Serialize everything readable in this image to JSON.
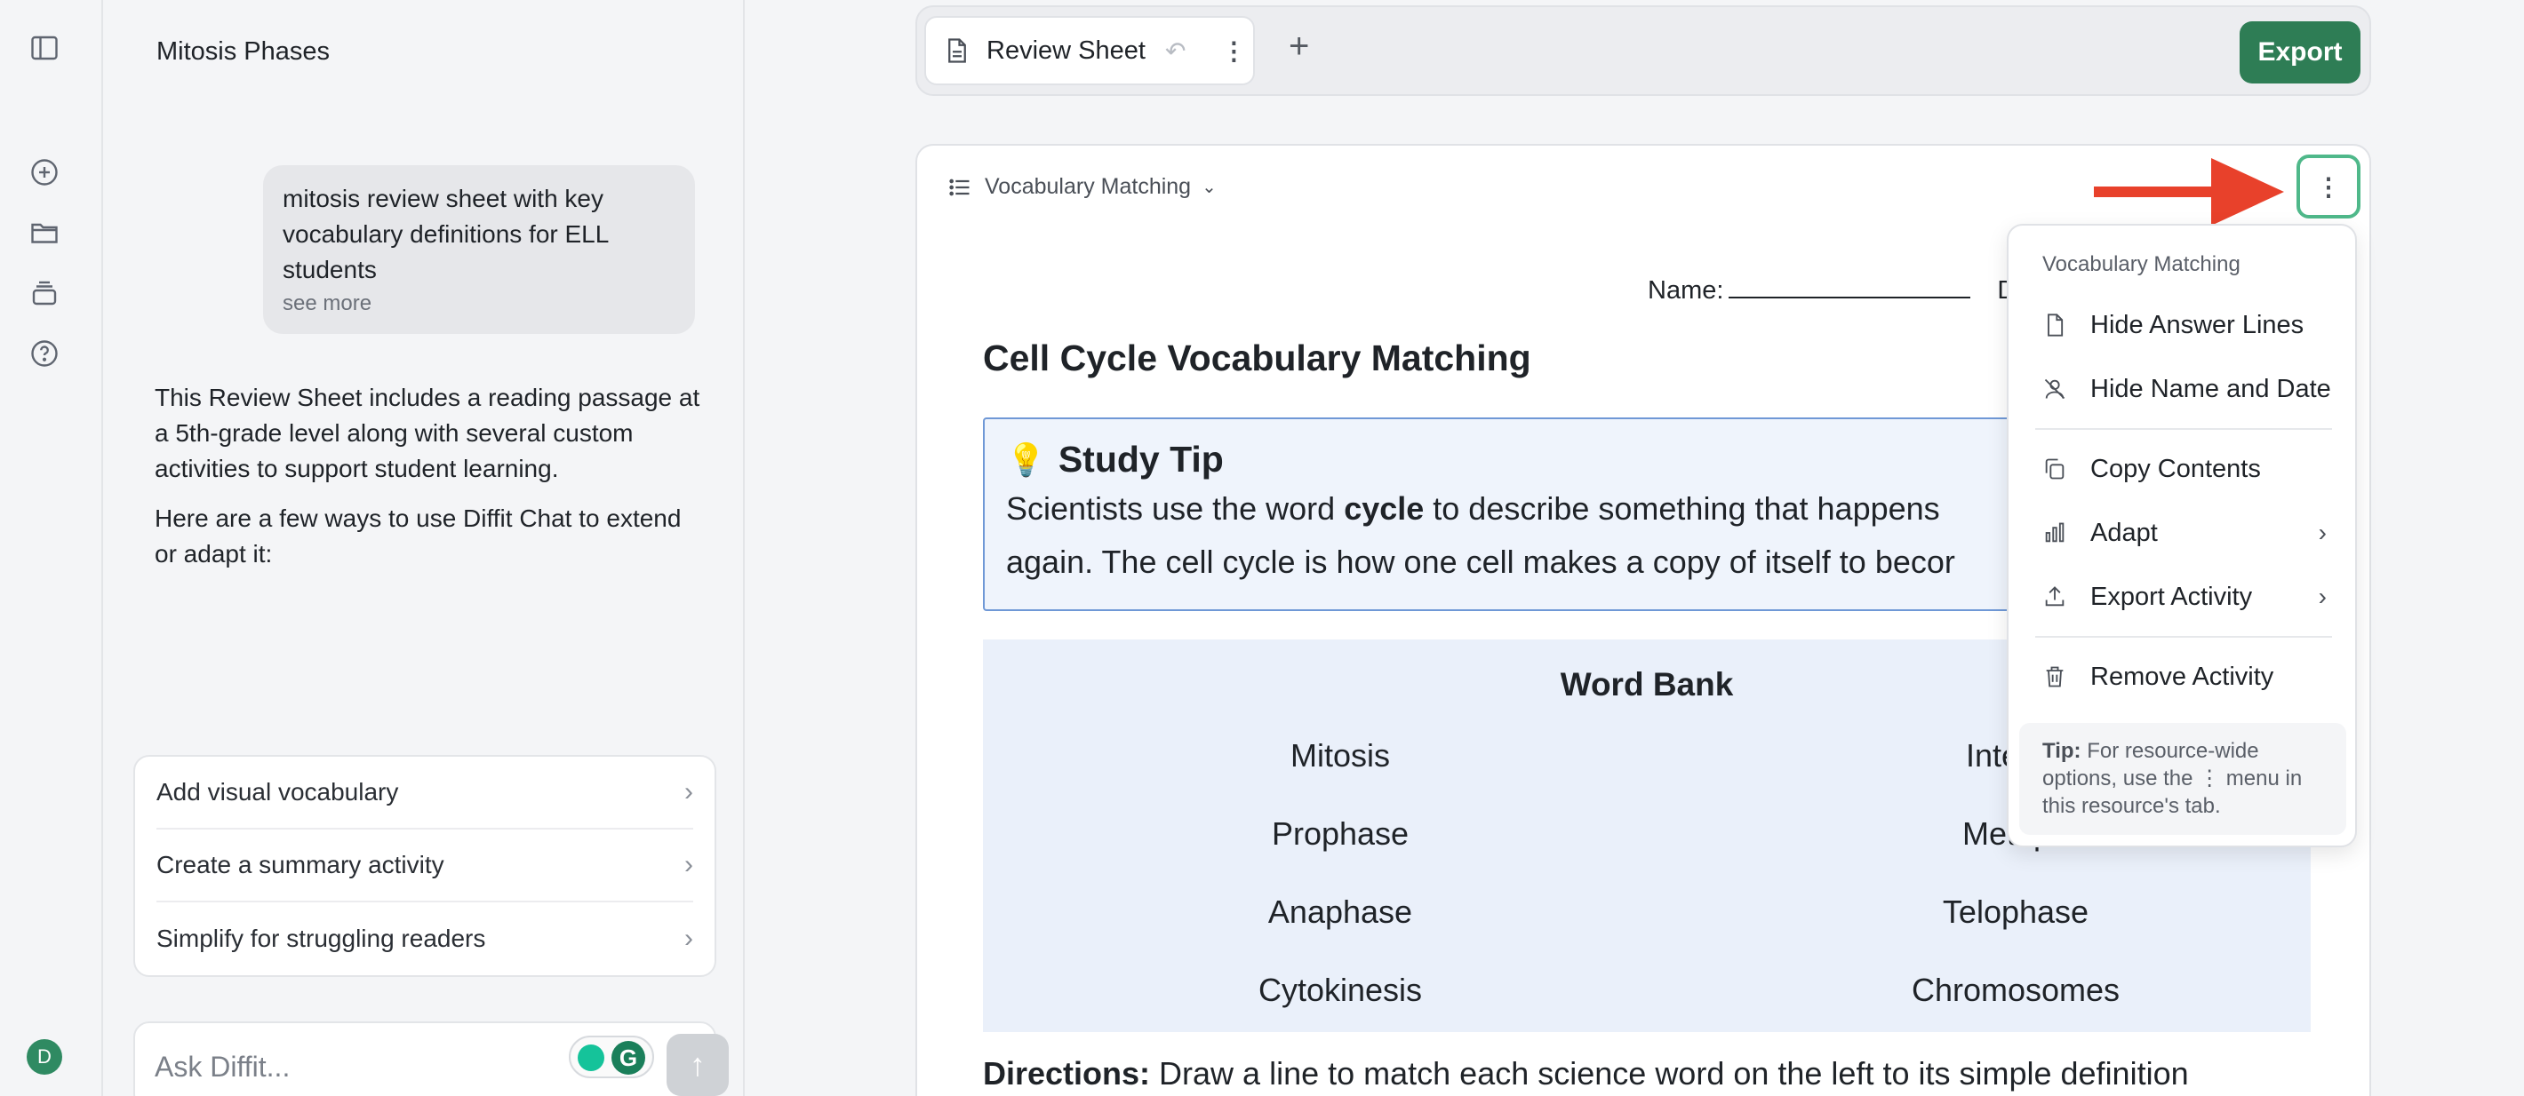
{
  "chat": {
    "title": "Mitosis Phases",
    "user_message": "mitosis review sheet with key vocabulary definitions for ELL students",
    "see_more": "see more",
    "reply_p1": "This Review Sheet includes a reading passage at a 5th-grade level along with several custom activities to support student learning.",
    "reply_p2": "Here are a few ways to use Diffit Chat to extend or adapt it:",
    "suggestions": [
      {
        "label": "Add visual vocabulary"
      },
      {
        "label": "Create a summary activity"
      },
      {
        "label": "Simplify for struggling readers"
      }
    ],
    "input_placeholder": "Ask Diffit...",
    "avatar_letter": "D"
  },
  "tabs": {
    "active_tab": "Review Sheet",
    "export_label": "Export"
  },
  "activity": {
    "selector_label": "Vocabulary Matching",
    "name_label": "Name:",
    "date_partial": "D",
    "title": "Cell Cycle Vocabulary Matching",
    "tip": {
      "heading": "Study Tip",
      "line1_pre": "Scientists use the word ",
      "line1_bold": "cycle",
      "line1_post": " to describe something that happens",
      "line2": "again. The cell cycle is how one cell makes a copy of itself to becor"
    },
    "word_bank": {
      "heading": "Word Bank",
      "left": [
        "Mitosis",
        "Prophase",
        "Anaphase",
        "Cytokinesis"
      ],
      "right": [
        "Interph",
        "Metaph",
        "Telophase",
        "Chromosomes"
      ]
    },
    "directions_label": "Directions:",
    "directions_text": " Draw a line to match each science word on the left to its simple definition"
  },
  "menu": {
    "header": "Vocabulary Matching",
    "items": [
      {
        "label": "Hide Answer Lines",
        "icon": "file-icon"
      },
      {
        "label": "Hide Name and Date",
        "icon": "user-off-icon"
      },
      {
        "label": "Copy Contents",
        "icon": "copy-icon"
      },
      {
        "label": "Adapt",
        "icon": "chart-icon"
      },
      {
        "label": "Export Activity",
        "icon": "upload-icon"
      },
      {
        "label": "Remove Activity",
        "icon": "trash-icon"
      }
    ],
    "tip_label": "Tip:",
    "tip_text": " For resource-wide options, use the ⋮ menu in this resource's tab."
  },
  "colors": {
    "accent_green": "#2e7d55",
    "arrow_red": "#e8412b",
    "focus_ring": "#4fb88a"
  }
}
